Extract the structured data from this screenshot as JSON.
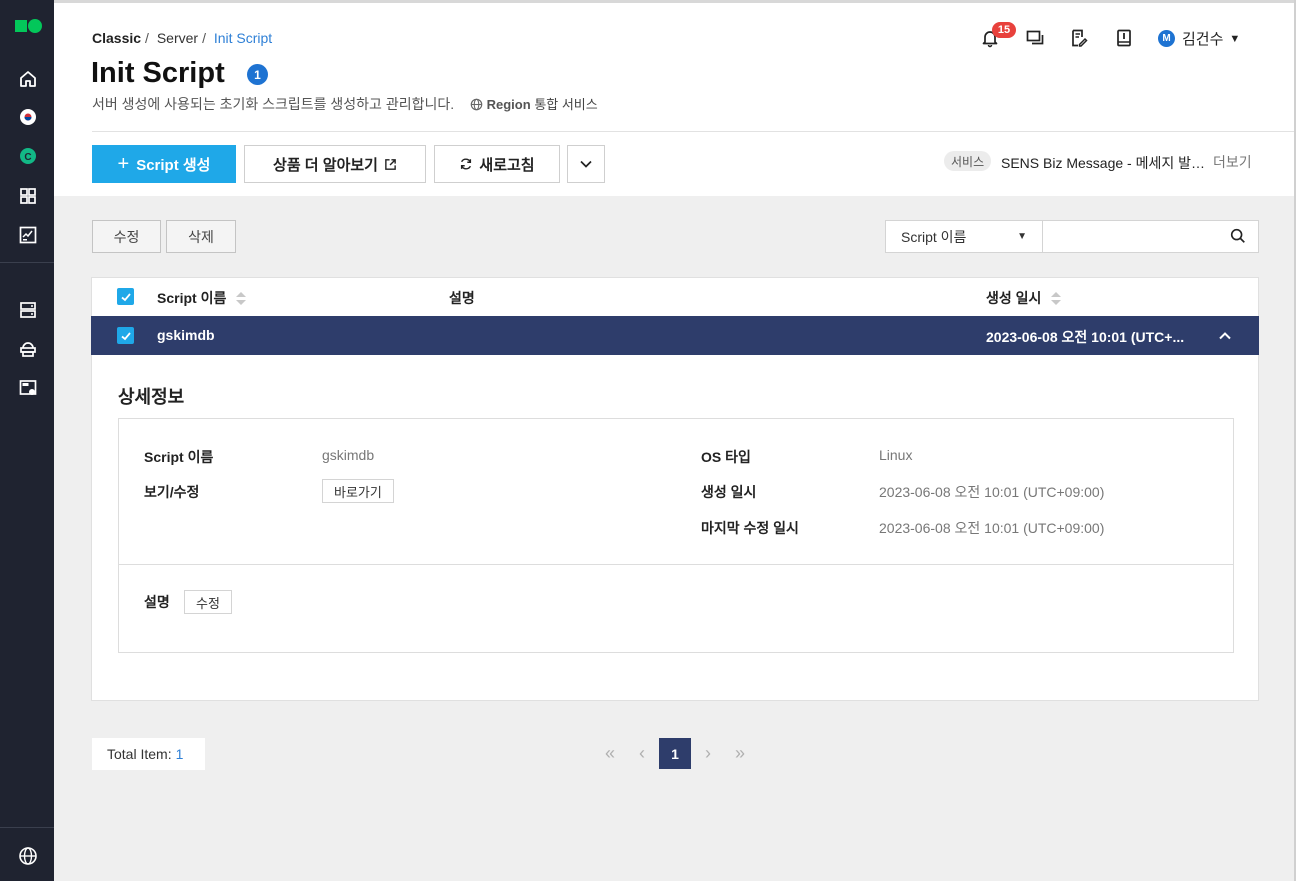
{
  "breadcrumb": {
    "root": "Classic",
    "section": "Server",
    "current": "Init Script"
  },
  "page": {
    "title": "Init Script",
    "count": "1",
    "subtitle": "서버 생성에 사용되는 초기화 스크립트를 생성하고 관리합니다.",
    "region_label": "Region",
    "region_text": "통합 서비스"
  },
  "header": {
    "notification_count": "15",
    "user_initial": "M",
    "user_name": "김건수"
  },
  "toolbar": {
    "create_label": "Script 생성",
    "learn_more_label": "상품 더 알아보기",
    "refresh_label": "새로고침"
  },
  "service_notice": {
    "tag": "서비스",
    "text": "SENS Biz Message - 메세지 발송 기능 안내",
    "more": "더보기"
  },
  "actions": {
    "edit": "수정",
    "delete": "삭제"
  },
  "search": {
    "field": "Script 이름",
    "placeholder": ""
  },
  "table": {
    "columns": [
      "Script 이름",
      "설명",
      "생성 일시"
    ],
    "rows": [
      {
        "name": "gskimdb",
        "description": "",
        "created": "2023-06-08 오전 10:01 (UTC+..."
      }
    ]
  },
  "detail": {
    "title": "상세정보",
    "name_label": "Script 이름",
    "name_value": "gskimdb",
    "view_edit_label": "보기/수정",
    "view_edit_button": "바로가기",
    "os_label": "OS 타입",
    "os_value": "Linux",
    "created_label": "생성 일시",
    "created_value": "2023-06-08 오전 10:01 (UTC+09:00)",
    "modified_label": "마지막 수정 일시",
    "modified_value": "2023-06-08 오전 10:01 (UTC+09:00)",
    "desc_label": "설명",
    "desc_button": "수정"
  },
  "footer": {
    "total_label": "Total Item:",
    "total_value": "1",
    "current_page": "1"
  },
  "colors": {
    "primary": "#1fa8e8",
    "navy": "#2e3d6b",
    "sidebar": "#1f2330",
    "badge_red": "#e8413c"
  }
}
